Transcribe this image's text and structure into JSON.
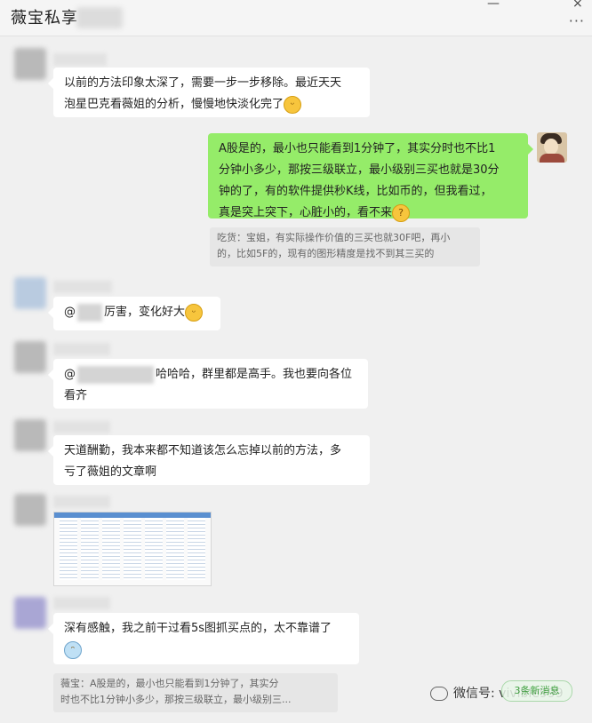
{
  "window": {
    "title": "薇宝私享",
    "min_icon": "—",
    "close_icon": "×",
    "more_icon": "···"
  },
  "messages": [
    {
      "text_line1": "以前的方法印象太深了，需要一步一步移除。最近天天",
      "text_line2": "泡星巴克看薇姐的分析，慢慢地快淡化完了",
      "emoji": "grin"
    },
    {
      "text_line1": "A股是的，最小也只能看到1分钟了，其实分时也不比1",
      "text_line2": "分钟小多少，那按三级联立，最小级别三买也就是30分",
      "text_line3": "钟的了，有的软件提供秒K线，比如币的，但我看过，",
      "text_line4": "真是突上突下，心脏小的，看不来",
      "emoji": "think",
      "quote_line1": "吃货：宝姐，有实际操作价值的三买也就30F吧，再小",
      "quote_line2": "的，比如5F的，现有的图形精度是找不到其三买的"
    },
    {
      "prefix": "@",
      "text": "厉害，变化好大",
      "emoji": "grin"
    },
    {
      "prefix": "@",
      "text_line1": "哈哈哈，群里都是高手。我也要向各位",
      "text_line2": "看齐"
    },
    {
      "text_line1": "天道酬勤，我本来都不知道该怎么忘掉以前的方法，多",
      "text_line2": "亏了薇姐的文章啊"
    },
    {
      "type": "image"
    },
    {
      "text_line1": "深有感触，我之前干过看5s图抓买点的，太不靠谱了",
      "emoji": "cry",
      "quote_line1": "薇宝：A股是的，最小也只能看到1分钟了，其实分",
      "quote_line2": "时也不比1分钟小多少，那按三级联立，最小级别三..."
    }
  ],
  "footer": {
    "watermark": "微信号: vivible999",
    "new_messages": "3条新消息"
  },
  "icons": {
    "more": "more-icon",
    "emoji_grin": "grin-emoji-icon",
    "emoji_think": "thinking-emoji-icon",
    "emoji_cry": "cry-emoji-icon",
    "wechat": "wechat-logo-icon"
  },
  "colors": {
    "self_bubble": "#95ec69",
    "other_bubble": "#ffffff",
    "background": "#f0f0f0",
    "quote_bg": "#e6e6e6"
  }
}
